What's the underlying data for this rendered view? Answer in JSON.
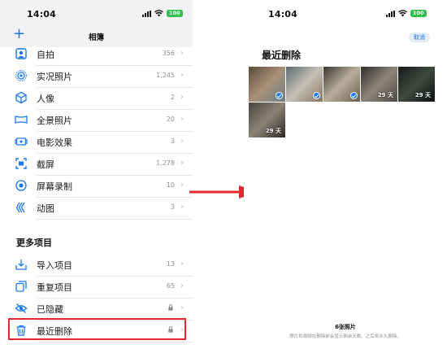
{
  "left": {
    "status": {
      "time": "14:04",
      "battery": "100"
    },
    "nav": {
      "title": "相簿",
      "add_label": "+"
    },
    "media_types": [
      {
        "name": "selfie",
        "label": "自拍",
        "count": "356",
        "icon": "person-square-icon"
      },
      {
        "name": "live-photos",
        "label": "实况照片",
        "count": "1,245",
        "icon": "live-photo-icon"
      },
      {
        "name": "portrait",
        "label": "人像",
        "count": "2",
        "icon": "cube-icon"
      },
      {
        "name": "panoramas",
        "label": "全景照片",
        "count": "20",
        "icon": "panorama-icon"
      },
      {
        "name": "cinematic",
        "label": "电影效果",
        "count": "3",
        "icon": "cinematic-icon"
      },
      {
        "name": "screenshots",
        "label": "截屏",
        "count": "1,278",
        "icon": "screenshot-icon"
      },
      {
        "name": "screen-recordings",
        "label": "屏幕录制",
        "count": "10",
        "icon": "record-icon"
      },
      {
        "name": "animated",
        "label": "动图",
        "count": "3",
        "icon": "animated-icon"
      }
    ],
    "more_items": {
      "header": "更多项目",
      "items": [
        {
          "name": "imports",
          "label": "导入项目",
          "count": "13",
          "icon": "import-icon"
        },
        {
          "name": "duplicates",
          "label": "重复项目",
          "count": "65",
          "icon": "duplicate-icon"
        },
        {
          "name": "hidden",
          "label": "已隐藏",
          "icon": "eye-slash-icon",
          "locked": true
        },
        {
          "name": "recently-deleted",
          "label": "最近删除",
          "icon": "trash-icon",
          "locked": true
        }
      ]
    }
  },
  "right": {
    "status": {
      "time": "14:04",
      "battery": "100"
    },
    "cancel_label": "取消",
    "title": "最近删除",
    "thumbnails": [
      {
        "days": "",
        "selected": true,
        "colors": [
          "#5b4a3a",
          "#a89078",
          "#6e7f86"
        ]
      },
      {
        "days": "",
        "selected": true,
        "colors": [
          "#5d6a70",
          "#c6c1b6",
          "#87735f"
        ]
      },
      {
        "days": "",
        "selected": true,
        "colors": [
          "#3c3730",
          "#b9ad9a",
          "#6b5d4b"
        ]
      },
      {
        "days": "29 天",
        "selected": false,
        "colors": [
          "#2f2e2c",
          "#8d8577",
          "#4f4a43"
        ]
      },
      {
        "days": "29 天",
        "selected": false,
        "colors": [
          "#17191a",
          "#3c4a3f",
          "#0d0f10"
        ]
      },
      {
        "days": "29 天",
        "selected": false,
        "colors": [
          "#4b4740",
          "#8b8272",
          "#2c2a27"
        ]
      }
    ],
    "footer": {
      "count": "6张照片",
      "note": "照片和视频在删除前会显示剩余天数。之后将永久删除。"
    }
  },
  "colors": {
    "accent": "#1877f2",
    "highlight": "#e8262f",
    "arrow": "#e8262f"
  }
}
